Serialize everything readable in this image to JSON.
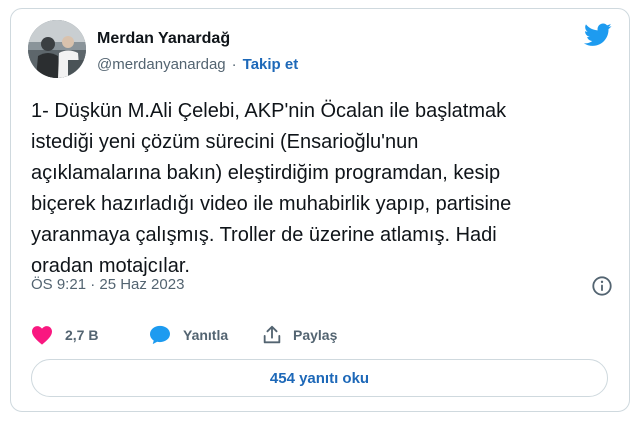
{
  "author": {
    "name": "Merdan Yanardağ",
    "handle": "@merdanyanardag",
    "follow_label": "Takip et",
    "separator": "·"
  },
  "tweet": {
    "text": "1- Düşkün M.Ali Çelebi, AKP'nin Öcalan ile başlatmak\nistediği yeni çözüm sürecini (Ensarioğlu'nun\naçıklamalarına bakın) eleştirdiğim programdan, kesip\nbiçerek hazırladığı video ile muhabirlik yapıp, partisine\nyaranmaya çalışmış. Troller de üzerine atlamış. Hadi\noradan motajcılar.",
    "timestamp": "ÖS 9:21 · 25 Haz 2023"
  },
  "actions": {
    "like_count": "2,7 B",
    "reply_label": "Yanıtla",
    "share_label": "Paylaş"
  },
  "replies_button": "454 yanıtı oku",
  "colors": {
    "accent": "#1d9bf0",
    "link": "#1d68b8",
    "like": "#f91880",
    "muted": "#536471",
    "border": "#cfd9de"
  }
}
